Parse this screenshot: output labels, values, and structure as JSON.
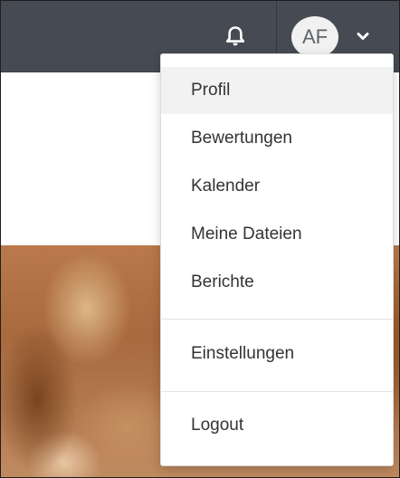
{
  "header": {
    "avatar_initials": "AF",
    "icons": {
      "notifications": "bell-icon",
      "dropdown_toggle": "chevron-down-icon"
    }
  },
  "user_menu": {
    "items": [
      {
        "label": "Profil",
        "active": true
      },
      {
        "label": "Bewertungen",
        "active": false
      },
      {
        "label": "Kalender",
        "active": false
      },
      {
        "label": "Meine Dateien",
        "active": false
      },
      {
        "label": "Berichte",
        "active": false
      },
      {
        "label": "Einstellungen",
        "active": false
      },
      {
        "label": "Logout",
        "active": false
      }
    ]
  },
  "colors": {
    "navbar": "#464a52",
    "avatar_bg": "#f1f1f1",
    "menu_active_bg": "#f2f2f2",
    "menu_text": "#333333"
  }
}
